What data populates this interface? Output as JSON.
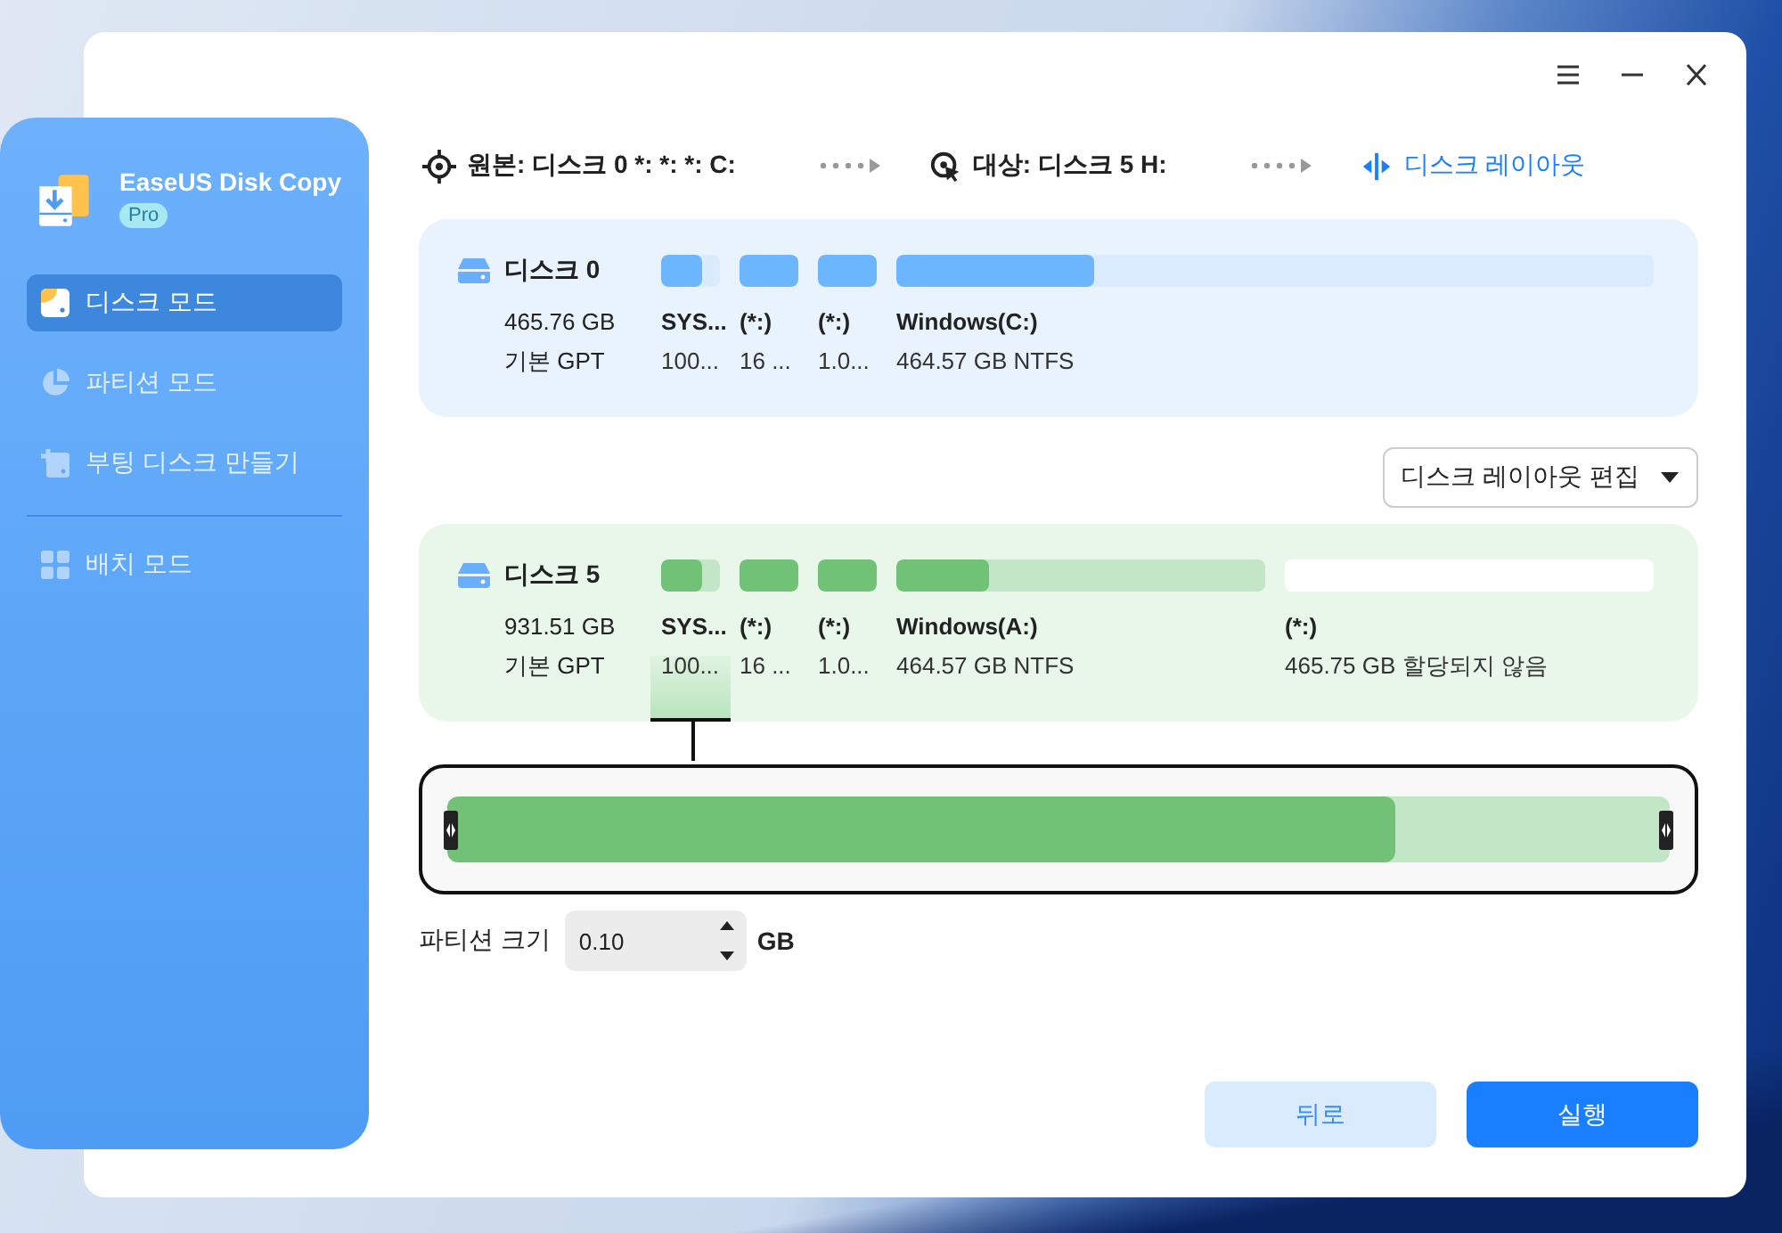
{
  "app": {
    "name": "EaseUS Disk Copy",
    "edition": "Pro"
  },
  "sidebar": {
    "items": [
      {
        "label": "디스크 모드",
        "selected": true,
        "disabled": false
      },
      {
        "label": "파티션 모드",
        "selected": false,
        "disabled": true
      },
      {
        "label": "부팅 디스크 만들기",
        "selected": false,
        "disabled": true
      },
      {
        "label": "배치 모드",
        "selected": false,
        "disabled": true
      }
    ]
  },
  "steps": [
    {
      "kind": "source",
      "label": "원본: 디스크 0 *: *: *: C:",
      "selected": false
    },
    {
      "kind": "target",
      "label": "대상: 디스크 5 H:",
      "selected": false
    },
    {
      "kind": "layout",
      "label": "디스크 레이아웃",
      "selected": true
    }
  ],
  "disks": [
    {
      "kind": "source",
      "name": "디스크 0",
      "size": "465.76 GB",
      "type": "기본 GPT",
      "partitions": [
        {
          "kind": "small",
          "name": "SYS...",
          "detail": "100...",
          "level": 0.7,
          "selected": false
        },
        {
          "kind": "small",
          "name": "(*:)",
          "detail": "16 ...",
          "level": 1,
          "selected": false
        },
        {
          "kind": "small",
          "name": "(*:)",
          "detail": "1.0...",
          "level": 1,
          "selected": false
        },
        {
          "kind": "wide",
          "name": "Windows(C:)",
          "detail": "464.57 GB NTFS",
          "level": 0.26,
          "selected": false
        }
      ]
    },
    {
      "kind": "target",
      "name": "디스크 5",
      "size": "931.51 GB",
      "type": "기본 GPT",
      "partitions": [
        {
          "kind": "small",
          "name": "SYS...",
          "detail": "100...",
          "level": 0.7,
          "selected": true
        },
        {
          "kind": "small",
          "name": "(*:)",
          "detail": "16 ...",
          "level": 1,
          "selected": false
        },
        {
          "kind": "small",
          "name": "(*:)",
          "detail": "1.0...",
          "level": 1,
          "selected": false
        },
        {
          "kind": "wide",
          "name": "Windows(A:)",
          "detail": "464.57 GB NTFS",
          "level": 0.25,
          "selected": false
        },
        {
          "kind": "unallocated",
          "name": "(*:)",
          "detail": "465.75 GB 할당되지 않음",
          "selected": false
        }
      ]
    }
  ],
  "layout_dropdown": {
    "value": "디스크 레이아웃 편집"
  },
  "resize_slider": {
    "level": 0.775
  },
  "partition_size": {
    "label": "파티션 크기",
    "value": "0.10",
    "unit": "GB"
  },
  "buttons": [
    {
      "kind": "secondary",
      "label": "뒤로"
    },
    {
      "kind": "primary",
      "label": "실행"
    }
  ]
}
